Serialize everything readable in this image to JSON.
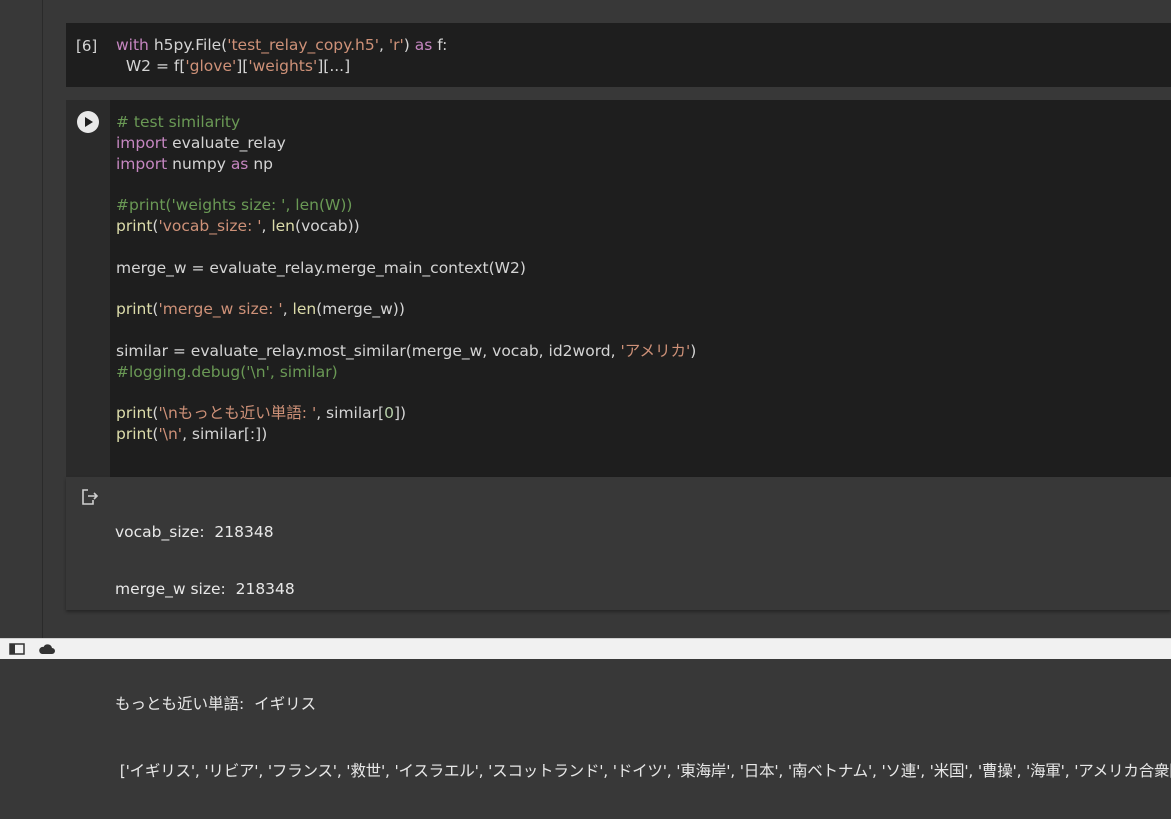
{
  "cell_6": {
    "prompt": "[6]",
    "lines": [
      [
        {
          "t": "with",
          "c": "k"
        },
        {
          "t": " h5py.File(",
          "c": ""
        },
        {
          "t": "'test_relay_copy.h5'",
          "c": "s"
        },
        {
          "t": ", ",
          "c": ""
        },
        {
          "t": "'r'",
          "c": "s"
        },
        {
          "t": ") ",
          "c": ""
        },
        {
          "t": "as",
          "c": "k"
        },
        {
          "t": " f:",
          "c": ""
        }
      ],
      [
        {
          "t": "  W2 = f[",
          "c": ""
        },
        {
          "t": "'glove'",
          "c": "s"
        },
        {
          "t": "][",
          "c": ""
        },
        {
          "t": "'weights'",
          "c": "s"
        },
        {
          "t": "][...]",
          "c": ""
        }
      ]
    ]
  },
  "cell_main": {
    "run_button_icon": "play-icon",
    "lines": [
      [
        {
          "t": "# test similarity",
          "c": "c"
        }
      ],
      [
        {
          "t": "import",
          "c": "k"
        },
        {
          "t": " evaluate_relay",
          "c": ""
        }
      ],
      [
        {
          "t": "import",
          "c": "k"
        },
        {
          "t": " numpy ",
          "c": ""
        },
        {
          "t": "as",
          "c": "k"
        },
        {
          "t": " np",
          "c": ""
        }
      ],
      [],
      [
        {
          "t": "#print('weights size: ', len(W))",
          "c": "c"
        }
      ],
      [
        {
          "t": "print",
          "c": "f"
        },
        {
          "t": "(",
          "c": ""
        },
        {
          "t": "'vocab_size: '",
          "c": "s"
        },
        {
          "t": ", ",
          "c": ""
        },
        {
          "t": "len",
          "c": "f"
        },
        {
          "t": "(vocab))",
          "c": ""
        }
      ],
      [],
      [
        {
          "t": "merge_w = evaluate_relay.merge_main_context(W2)",
          "c": ""
        }
      ],
      [],
      [
        {
          "t": "print",
          "c": "f"
        },
        {
          "t": "(",
          "c": ""
        },
        {
          "t": "'merge_w size: '",
          "c": "s"
        },
        {
          "t": ", ",
          "c": ""
        },
        {
          "t": "len",
          "c": "f"
        },
        {
          "t": "(merge_w))",
          "c": ""
        }
      ],
      [],
      [
        {
          "t": "similar = evaluate_relay.most_similar(merge_w, vocab, id2word, ",
          "c": ""
        },
        {
          "t": "'アメリカ'",
          "c": "s"
        },
        {
          "t": ")",
          "c": ""
        }
      ],
      [
        {
          "t": "#logging.debug('\\n', similar)",
          "c": "c"
        }
      ],
      [],
      [
        {
          "t": "print",
          "c": "f"
        },
        {
          "t": "(",
          "c": ""
        },
        {
          "t": "'\\nもっとも近い単語: '",
          "c": "s"
        },
        {
          "t": ", similar[",
          "c": ""
        },
        {
          "t": "0",
          "c": "n"
        },
        {
          "t": "])",
          "c": ""
        }
      ],
      [
        {
          "t": "print",
          "c": "f"
        },
        {
          "t": "(",
          "c": ""
        },
        {
          "t": "'\\n'",
          "c": "s"
        },
        {
          "t": ", similar[:])",
          "c": ""
        }
      ]
    ]
  },
  "output": {
    "icon": "output-icon",
    "vocab_line": "vocab_size:  218348",
    "merge_line": "merge_w size:  218348",
    "nearest_line": "もっとも近い単語:  イギリス",
    "list_line": " ['イギリス', 'リビア', 'フランス', '救世', 'イスラエル', 'スコットランド', 'ドイツ', '東海岸', '日本', '南ベトナム', 'ソ連', '米国', '曹操', '海軍', 'アメリカ合衆国']"
  },
  "statusbar": {
    "icons": [
      "terminal-icon",
      "cloud-icon"
    ]
  },
  "colors": {
    "keyword": "#c586c0",
    "string": "#ce9178",
    "function": "#dcdcaa",
    "comment": "#6a9955",
    "number": "#b5cea8",
    "code_bg": "#1e1e1e",
    "page_bg": "#383838"
  }
}
